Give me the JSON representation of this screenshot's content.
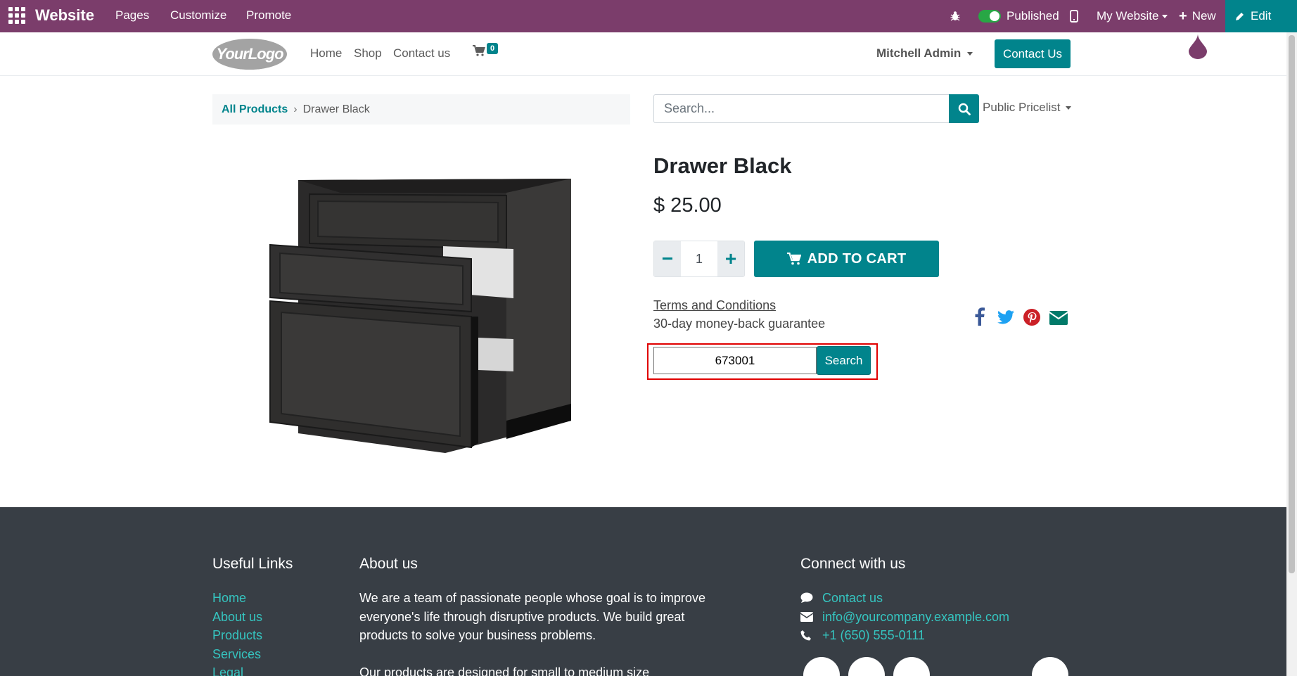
{
  "admin_bar": {
    "brand": "Website",
    "menu": [
      "Pages",
      "Customize",
      "Promote"
    ],
    "published_label": "Published",
    "website_selector": "My Website",
    "new_label": "New",
    "edit_label": "Edit"
  },
  "site_header": {
    "logo_text": "YourLogo",
    "nav": [
      "Home",
      "Shop",
      "Contact us"
    ],
    "cart_count": "0",
    "user_name": "Mitchell Admin",
    "contact_button": "Contact Us"
  },
  "breadcrumb": {
    "root": "All Products",
    "current": "Drawer Black"
  },
  "product_search": {
    "placeholder": "Search...",
    "pricelist": "Public Pricelist"
  },
  "product": {
    "name": "Drawer Black",
    "price": "$ 25.00",
    "quantity": "1",
    "add_to_cart": "ADD TO CART",
    "terms": "Terms and Conditions",
    "guarantee": "30-day money-back guarantee"
  },
  "pincode": {
    "value": "673001",
    "button": "Search"
  },
  "footer": {
    "useful_links_title": "Useful Links",
    "useful_links": [
      "Home",
      "About us",
      "Products",
      "Services",
      "Legal"
    ],
    "about_title": "About us",
    "about_p1": "We are a team of passionate people whose goal is to improve everyone's life through disruptive products. We build great products to solve your business problems.",
    "about_p2": "Our products are designed for small to medium size",
    "connect_title": "Connect with us",
    "connect_contact": "Contact us",
    "connect_email": "info@yourcompany.example.com",
    "connect_phone": "+1 (650) 555-0111"
  },
  "colors": {
    "admin_bar": "#7b3d6b",
    "accent": "#01848c",
    "footer_bg": "#383e45",
    "footer_link": "#35c5c0",
    "highlight": "#e00000"
  }
}
